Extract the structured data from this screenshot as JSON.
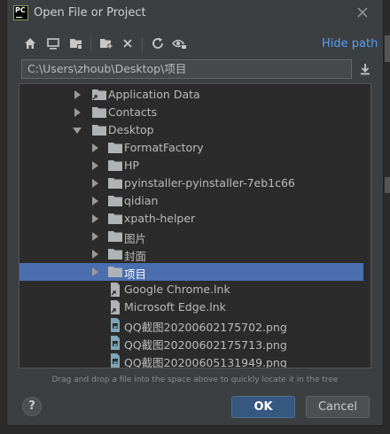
{
  "window": {
    "title": "Open File or Project",
    "logo_text": "PC"
  },
  "toolbar": {
    "buttons": [
      "home-icon",
      "desktop-icon",
      "project-folder-icon",
      "new-folder-icon",
      "delete-icon",
      "refresh-icon",
      "show-hidden-icon"
    ],
    "hide_path_label": "Hide path"
  },
  "path": {
    "value": "C:\\Users\\zhoub\\Desktop\\项目"
  },
  "tree": {
    "items": [
      {
        "label": "Application Data",
        "icon": "linked-folder-icon",
        "expander": "right"
      },
      {
        "label": "Contacts",
        "icon": "folder-icon",
        "expander": "right"
      },
      {
        "label": "Desktop",
        "icon": "folder-icon",
        "expander": "down"
      },
      {
        "label": "FormatFactory",
        "icon": "folder-icon",
        "expander": "right"
      },
      {
        "label": "HP",
        "icon": "folder-icon",
        "expander": "right"
      },
      {
        "label": "pyinstaller-pyinstaller-7eb1c66",
        "icon": "folder-icon",
        "expander": "right"
      },
      {
        "label": "qidian",
        "icon": "folder-icon",
        "expander": "right"
      },
      {
        "label": "xpath-helper",
        "icon": "folder-icon",
        "expander": "right"
      },
      {
        "label": "图片",
        "icon": "folder-icon",
        "expander": "right"
      },
      {
        "label": "封面",
        "icon": "folder-icon",
        "expander": "right"
      },
      {
        "label": "项目",
        "icon": "folder-icon",
        "expander": "right",
        "selected": true
      },
      {
        "label": "Google Chrome.lnk",
        "icon": "shortcut-file-icon",
        "expander": "none"
      },
      {
        "label": "Microsoft Edge.lnk",
        "icon": "shortcut-file-icon",
        "expander": "none"
      },
      {
        "label": "QQ截图20200602175702.png",
        "icon": "image-file-icon",
        "expander": "none"
      },
      {
        "label": "QQ截图20200602175713.png",
        "icon": "image-file-icon",
        "expander": "none"
      },
      {
        "label": "QQ截图20200605131949.png",
        "icon": "image-file-icon",
        "expander": "none"
      }
    ]
  },
  "hint": "Drag and drop a file into the space above to quickly locate it in the tree",
  "footer": {
    "help_label": "?",
    "ok_label": "OK",
    "cancel_label": "Cancel"
  },
  "colors": {
    "accent": "#589df6",
    "selection": "#4b6eaf",
    "dialog_bg": "#3c3f41",
    "tree_bg": "#2b2b2b"
  }
}
